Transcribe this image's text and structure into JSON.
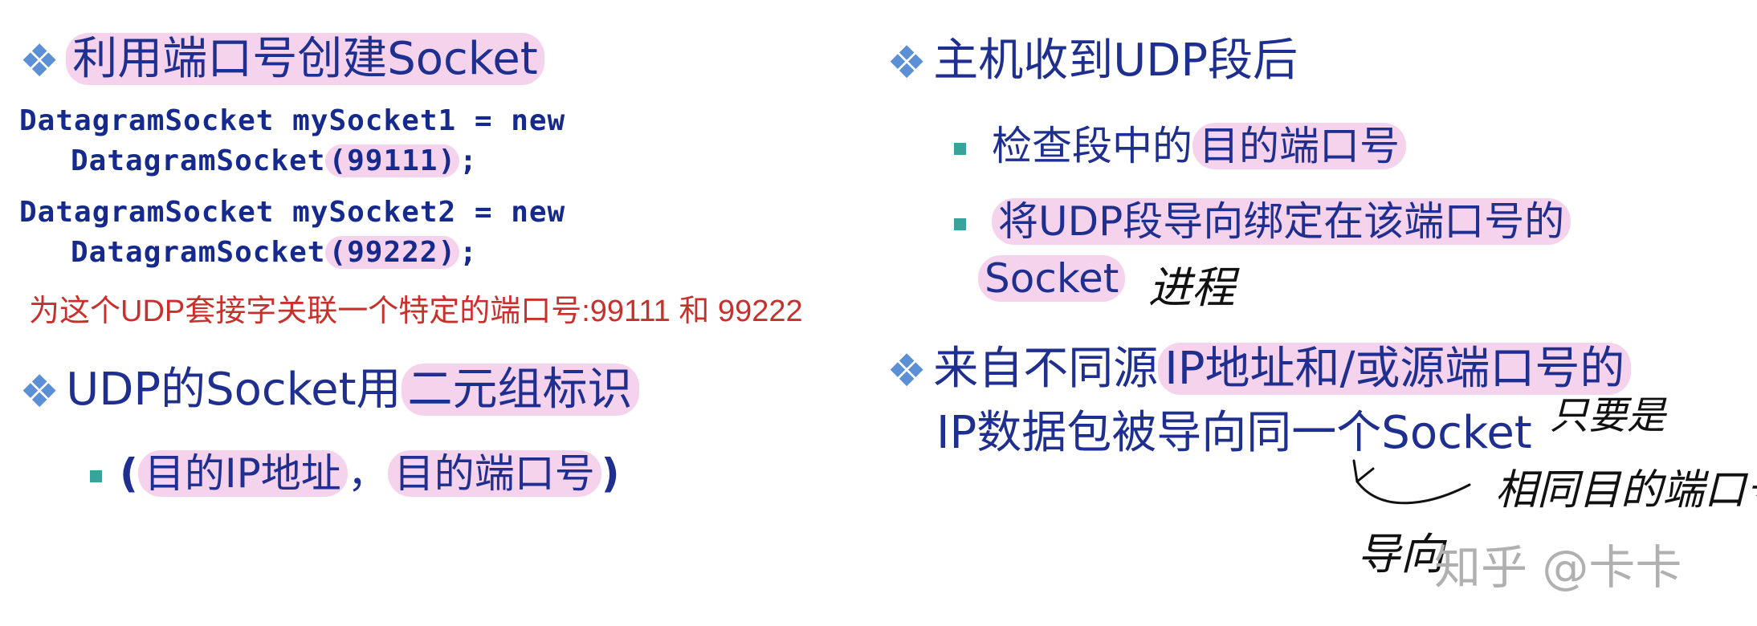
{
  "left": {
    "heading1": {
      "plain": "",
      "highlight": "利用端口号创建Socket"
    },
    "code": {
      "line1": "DatagramSocket mySocket1 = new",
      "line2_text": "DatagramSocket",
      "line2_arg": "(99111)",
      "line2_end": ";",
      "line3": "DatagramSocket mySocket2 = new",
      "line4_text": "DatagramSocket",
      "line4_arg": "(99222)",
      "line4_end": ";"
    },
    "note": "为这个UDP套接字关联一个特定的端口号:99111 和 99222",
    "heading2": {
      "plain": "UDP的Socket用",
      "highlight": "二元组标识"
    },
    "tuple": {
      "open": "(",
      "part1": "目的IP地址",
      "sep": "，",
      "part2": "目的端口号",
      "close": ")"
    }
  },
  "right": {
    "heading1": "主机收到UDP段后",
    "bullet1": {
      "plain": "检查段中的",
      "highlight": "目的端口号"
    },
    "bullet2": {
      "line1": "将UDP段导向绑定在该端口号的",
      "line2": "Socket"
    },
    "handnote1": "进程",
    "bullet3": {
      "line1_a": "来自不同源",
      "line1_hl": "IP地址和/或源端口号的",
      "line2": "IP数据包被导向同一个Socket"
    },
    "handnote2": "只要是",
    "handnote3": "相同目的端口号",
    "handnote4": "导向"
  },
  "watermark": "知乎 @卡卡",
  "colors": {
    "text_blue": "#1f2f8f",
    "highlight_pink": "#f6d3ec",
    "note_red": "#c8302c",
    "bullet_teal": "#38a39a",
    "diamond_blue": "#5b8fd6"
  }
}
